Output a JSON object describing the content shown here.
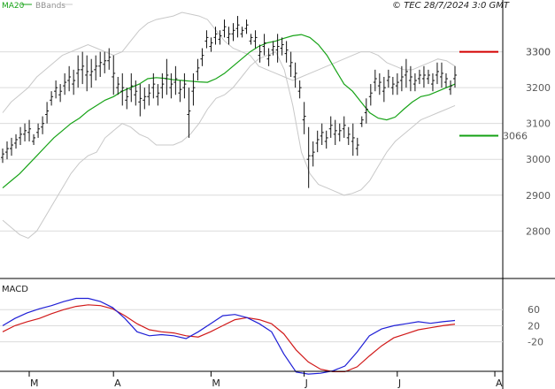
{
  "header": {
    "legend_ma": "MA20",
    "legend_bb": "BBands",
    "copyright": "© TEC 28/7/2024 3:0 GMT"
  },
  "colors": {
    "ma": "#17a317",
    "bands": "#c8c8c8",
    "price_bars": "#111111",
    "resistance": "#d40000",
    "support": "#13a113",
    "macd": "#1f1fd6",
    "signal": "#d11a1a",
    "grid": "#dcdcdc"
  },
  "levels": {
    "resistance_label": "3300",
    "resistance_value": 3300,
    "support_label": "3066",
    "support_value": 3066
  },
  "macd_panel": {
    "title": "MACD"
  },
  "chart_data": [
    {
      "type": "line",
      "role": "price-ohlc",
      "y_ticks": [
        2800,
        2900,
        3000,
        3100,
        3200,
        3300
      ],
      "ylim": [
        2670,
        3410
      ],
      "grid": true,
      "x_months": [
        "M",
        "A",
        "M",
        "J",
        "J",
        "A"
      ],
      "month_start_index": [
        0,
        19,
        41,
        62,
        83,
        105
      ],
      "bars": [
        [
          3030,
          2990
        ],
        [
          3050,
          3000
        ],
        [
          3060,
          3010
        ],
        [
          3070,
          3030
        ],
        [
          3090,
          3040
        ],
        [
          3100,
          3050
        ],
        [
          3110,
          3050
        ],
        [
          3070,
          3040
        ],
        [
          3100,
          3060
        ],
        [
          3120,
          3070
        ],
        [
          3160,
          3100
        ],
        [
          3190,
          3150
        ],
        [
          3220,
          3170
        ],
        [
          3210,
          3160
        ],
        [
          3240,
          3180
        ],
        [
          3260,
          3190
        ],
        [
          3250,
          3180
        ],
        [
          3290,
          3200
        ],
        [
          3300,
          3210
        ],
        [
          3290,
          3190
        ],
        [
          3280,
          3200
        ],
        [
          3290,
          3220
        ],
        [
          3300,
          3230
        ],
        [
          3300,
          3240
        ],
        [
          3310,
          3250
        ],
        [
          3290,
          3180
        ],
        [
          3230,
          3180
        ],
        [
          3240,
          3150
        ],
        [
          3200,
          3140
        ],
        [
          3240,
          3160
        ],
        [
          3220,
          3150
        ],
        [
          3210,
          3120
        ],
        [
          3200,
          3140
        ],
        [
          3210,
          3150
        ],
        [
          3240,
          3170
        ],
        [
          3210,
          3150
        ],
        [
          3240,
          3170
        ],
        [
          3280,
          3180
        ],
        [
          3240,
          3170
        ],
        [
          3260,
          3180
        ],
        [
          3220,
          3160
        ],
        [
          3240,
          3170
        ],
        [
          3200,
          3060
        ],
        [
          3240,
          3150
        ],
        [
          3280,
          3220
        ],
        [
          3310,
          3260
        ],
        [
          3360,
          3310
        ],
        [
          3340,
          3300
        ],
        [
          3370,
          3320
        ],
        [
          3360,
          3320
        ],
        [
          3390,
          3340
        ],
        [
          3370,
          3320
        ],
        [
          3380,
          3330
        ],
        [
          3400,
          3340
        ],
        [
          3370,
          3340
        ],
        [
          3390,
          3350
        ],
        [
          3350,
          3320
        ],
        [
          3360,
          3310
        ],
        [
          3320,
          3270
        ],
        [
          3350,
          3290
        ],
        [
          3310,
          3260
        ],
        [
          3330,
          3290
        ],
        [
          3350,
          3270
        ],
        [
          3340,
          3290
        ],
        [
          3330,
          3270
        ],
        [
          3300,
          3230
        ],
        [
          3270,
          3200
        ],
        [
          3220,
          3170
        ],
        [
          3160,
          3070
        ],
        [
          3090,
          2920
        ],
        [
          3050,
          2980
        ],
        [
          3080,
          3020
        ],
        [
          3100,
          3040
        ],
        [
          3080,
          3030
        ],
        [
          3120,
          3060
        ],
        [
          3110,
          3040
        ],
        [
          3100,
          3050
        ],
        [
          3120,
          3060
        ],
        [
          3090,
          3040
        ],
        [
          3100,
          3010
        ],
        [
          3060,
          3010
        ],
        [
          3120,
          3090
        ],
        [
          3170,
          3100
        ],
        [
          3210,
          3150
        ],
        [
          3250,
          3190
        ],
        [
          3240,
          3180
        ],
        [
          3230,
          3160
        ],
        [
          3250,
          3200
        ],
        [
          3230,
          3180
        ],
        [
          3240,
          3180
        ],
        [
          3260,
          3190
        ],
        [
          3280,
          3200
        ],
        [
          3260,
          3190
        ],
        [
          3240,
          3190
        ],
        [
          3250,
          3210
        ],
        [
          3260,
          3200
        ],
        [
          3250,
          3210
        ],
        [
          3240,
          3190
        ],
        [
          3270,
          3210
        ],
        [
          3270,
          3200
        ],
        [
          3240,
          3200
        ],
        [
          3220,
          3180
        ],
        [
          3260,
          3200
        ]
      ],
      "ma20": [
        2920,
        2940,
        2960,
        2985,
        3010,
        3035,
        3060,
        3080,
        3100,
        3115,
        3135,
        3150,
        3165,
        3175,
        3190,
        3200,
        3210,
        3225,
        3228,
        3226,
        3222,
        3220,
        3218,
        3216,
        3215,
        3225,
        3240,
        3260,
        3280,
        3300,
        3315,
        3325,
        3330,
        3338,
        3345,
        3348,
        3340,
        3320,
        3290,
        3250,
        3210,
        3190,
        3160,
        3130,
        3115,
        3110,
        3118,
        3140,
        3160,
        3175,
        3180,
        3190,
        3200,
        3210
      ],
      "bb_upper": [
        3130,
        3160,
        3180,
        3200,
        3230,
        3250,
        3270,
        3290,
        3300,
        3310,
        3320,
        3310,
        3300,
        3290,
        3300,
        3330,
        3360,
        3380,
        3390,
        3395,
        3400,
        3410,
        3405,
        3400,
        3390,
        3360,
        3330,
        3310,
        3300,
        3290,
        3260,
        3250,
        3240,
        3230,
        3220,
        3230,
        3240,
        3250,
        3260,
        3270,
        3280,
        3290,
        3300,
        3300,
        3290,
        3270,
        3260,
        3250,
        3250,
        3260,
        3270,
        3280,
        3275,
        3260
      ],
      "bb_lower": [
        2830,
        2810,
        2790,
        2780,
        2800,
        2840,
        2880,
        2920,
        2960,
        2990,
        3010,
        3020,
        3060,
        3080,
        3100,
        3090,
        3070,
        3060,
        3040,
        3040,
        3040,
        3050,
        3070,
        3100,
        3140,
        3170,
        3180,
        3200,
        3230,
        3260,
        3280,
        3290,
        3300,
        3250,
        3150,
        3020,
        2960,
        2930,
        2920,
        2910,
        2900,
        2905,
        2915,
        2940,
        2980,
        3020,
        3050,
        3070,
        3090,
        3110,
        3120,
        3130,
        3140,
        3150
      ]
    },
    {
      "type": "line",
      "role": "macd",
      "y_ticks": [
        60,
        20,
        -20
      ],
      "ylim": [
        -80,
        100
      ],
      "series": [
        {
          "role": "macd",
          "values": [
            20,
            38,
            52,
            62,
            70,
            80,
            88,
            88,
            80,
            65,
            38,
            5,
            -5,
            -2,
            -5,
            -12,
            5,
            25,
            45,
            48,
            40,
            25,
            5,
            -50,
            -95,
            -100,
            -98,
            -92,
            -80,
            -45,
            -5,
            12,
            20,
            25,
            30,
            26,
            30,
            33
          ]
        },
        {
          "role": "signal",
          "values": [
            5,
            20,
            30,
            38,
            50,
            60,
            68,
            72,
            70,
            62,
            45,
            25,
            10,
            5,
            2,
            -5,
            -8,
            5,
            20,
            35,
            40,
            35,
            25,
            0,
            -40,
            -70,
            -88,
            -94,
            -94,
            -82,
            -55,
            -30,
            -10,
            0,
            10,
            15,
            20,
            24
          ]
        }
      ]
    }
  ]
}
